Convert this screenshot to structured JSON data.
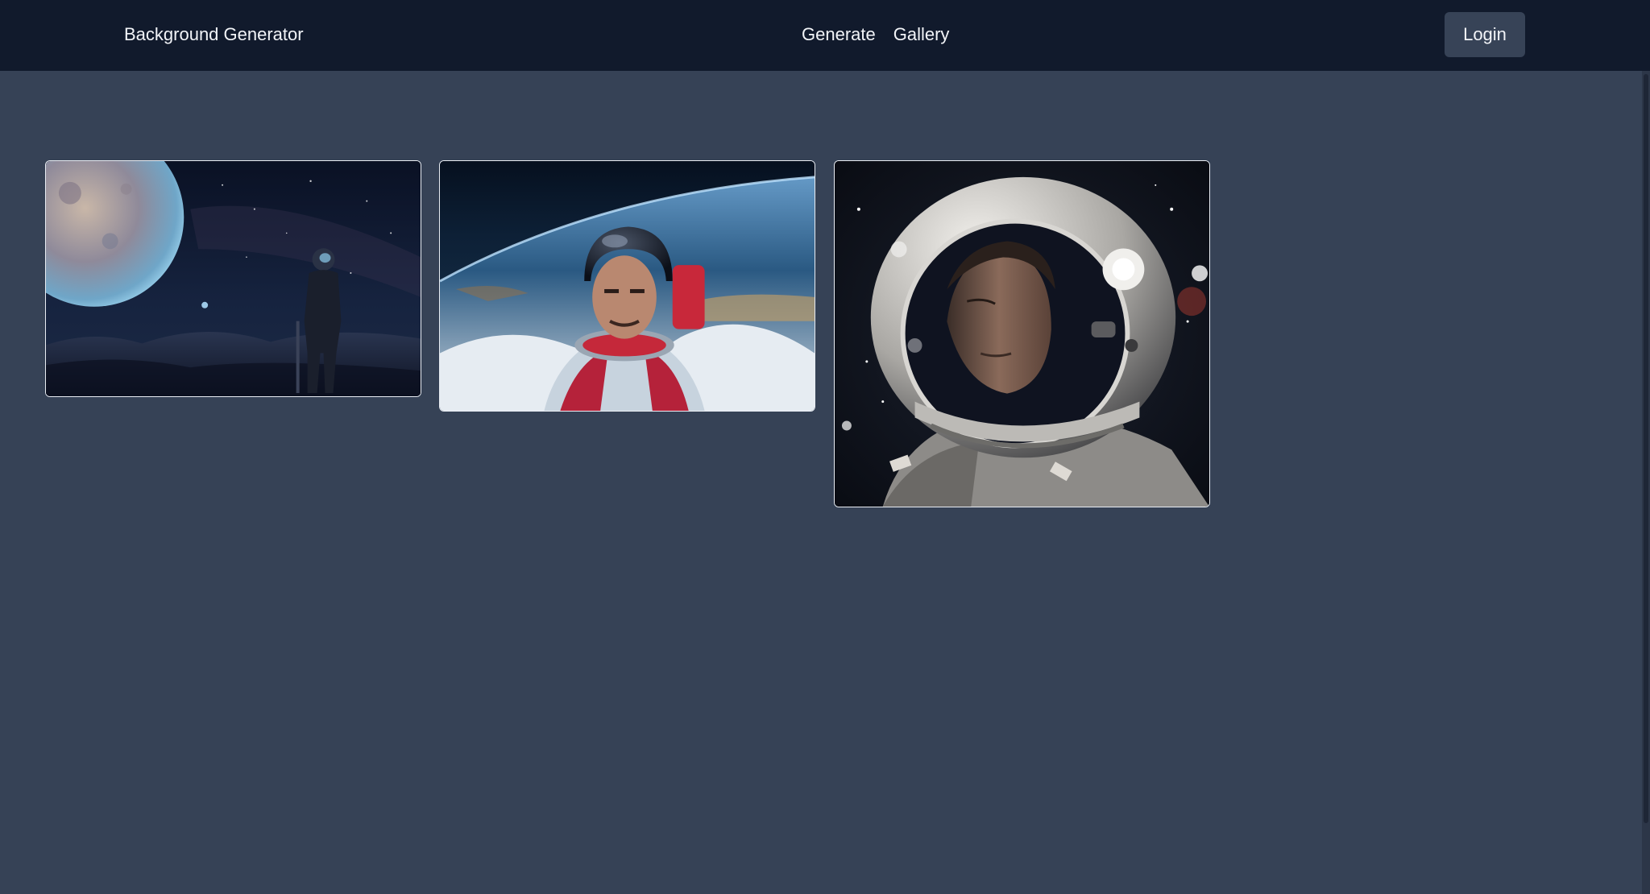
{
  "navbar": {
    "brand": "Background Generator",
    "links": [
      "Generate",
      "Gallery"
    ],
    "login_label": "Login"
  },
  "gallery": {
    "images": [
      {
        "depicts": "astronaut-looking-at-moon"
      },
      {
        "depicts": "astronaut-red-suit-above-earth"
      },
      {
        "depicts": "astronaut-portrait-white-helmet"
      }
    ]
  },
  "colors": {
    "navbar_bg": "#111a2c",
    "page_bg": "#364256",
    "button_bg": "#374357",
    "text": "#f2f4f8"
  }
}
